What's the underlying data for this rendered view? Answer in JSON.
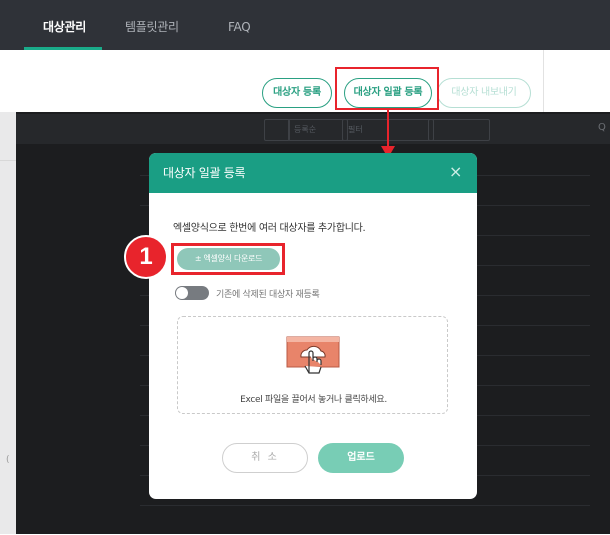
{
  "nav": {
    "tabs": [
      {
        "label": "대상관리",
        "active": true
      },
      {
        "label": "템플릿관리",
        "active": false
      },
      {
        "label": "FAQ",
        "active": false
      }
    ]
  },
  "toolbar": {
    "register_label": "대상자 등록",
    "bulk_register_label": "대상자 일괄 등록",
    "export_label": "대상자 내보내기"
  },
  "background": {
    "sort_label": "등록순",
    "filter_label": "필터",
    "edge_glyph": "(",
    "search_glyph": "Q"
  },
  "modal": {
    "title": "대상자 일괄 등록",
    "close_glyph": "×",
    "description": "엑셀양식으로 한번에 여러 대상자를 추가합니다.",
    "download_label": "± 엑셀양식 다운로드",
    "toggle_label": "기존에 삭제된 대상자 재등록",
    "toggle_on": false,
    "dropzone_text": "Excel 파일을 끌어서 놓거나 클릭하세요.",
    "cancel_label": "취 소",
    "upload_label": "업로드"
  },
  "annotation": {
    "step_number": "1"
  },
  "colors": {
    "nav_bg": "#2f3238",
    "accent": "#1a9e84",
    "highlight": "#e8242c"
  },
  "icons": [
    "close-icon",
    "download-icon",
    "upload-cloud-icon",
    "hand-pointer-icon",
    "arrow-down-icon"
  ]
}
